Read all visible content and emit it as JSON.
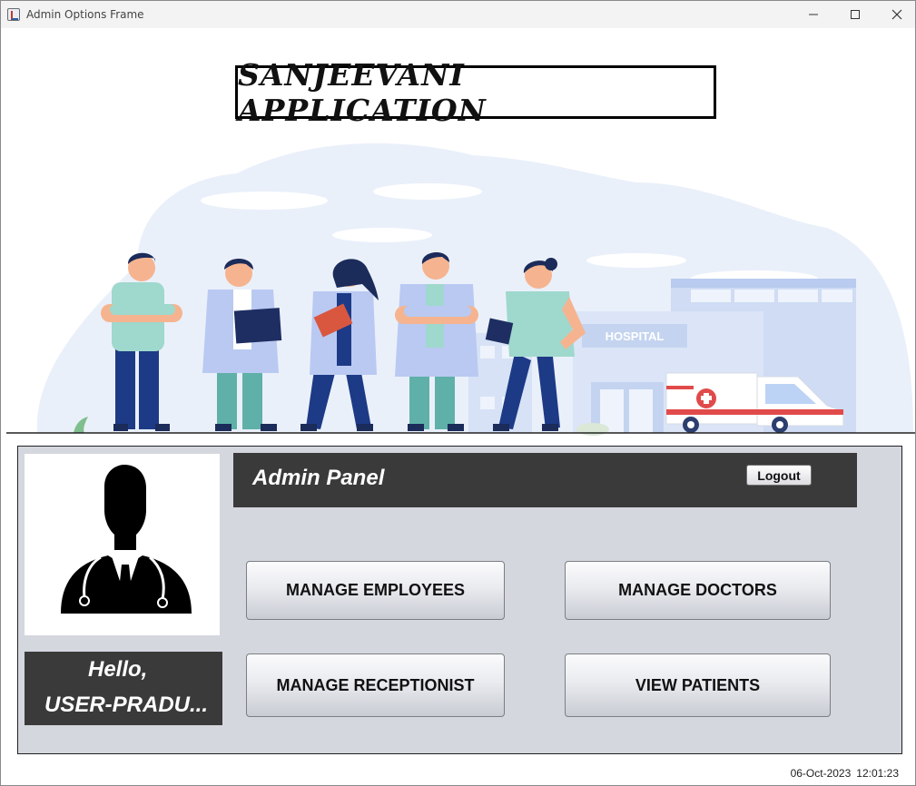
{
  "window": {
    "title": "Admin Options Frame"
  },
  "app_title": "SANJEEVANI APPLICATION",
  "illustration": {
    "hospital_sign": "HOSPITAL"
  },
  "profile": {
    "greeting_line1": "Hello,",
    "greeting_line2": "USER-PRADU..."
  },
  "header": {
    "title": "Admin Panel",
    "logout_label": "Logout"
  },
  "actions": {
    "manage_employees": "MANAGE EMPLOYEES",
    "manage_doctors": "MANAGE DOCTORS",
    "manage_receptionist": "MANAGE RECEPTIONIST",
    "view_patients": "VIEW PATIENTS"
  },
  "status": {
    "date": "06-Oct-2023",
    "time": "12:01:23"
  },
  "colors": {
    "dark_bar": "#3a3a3a",
    "panel_bg": "#d4d7de",
    "illustration_blue": "#dfe8f7"
  }
}
